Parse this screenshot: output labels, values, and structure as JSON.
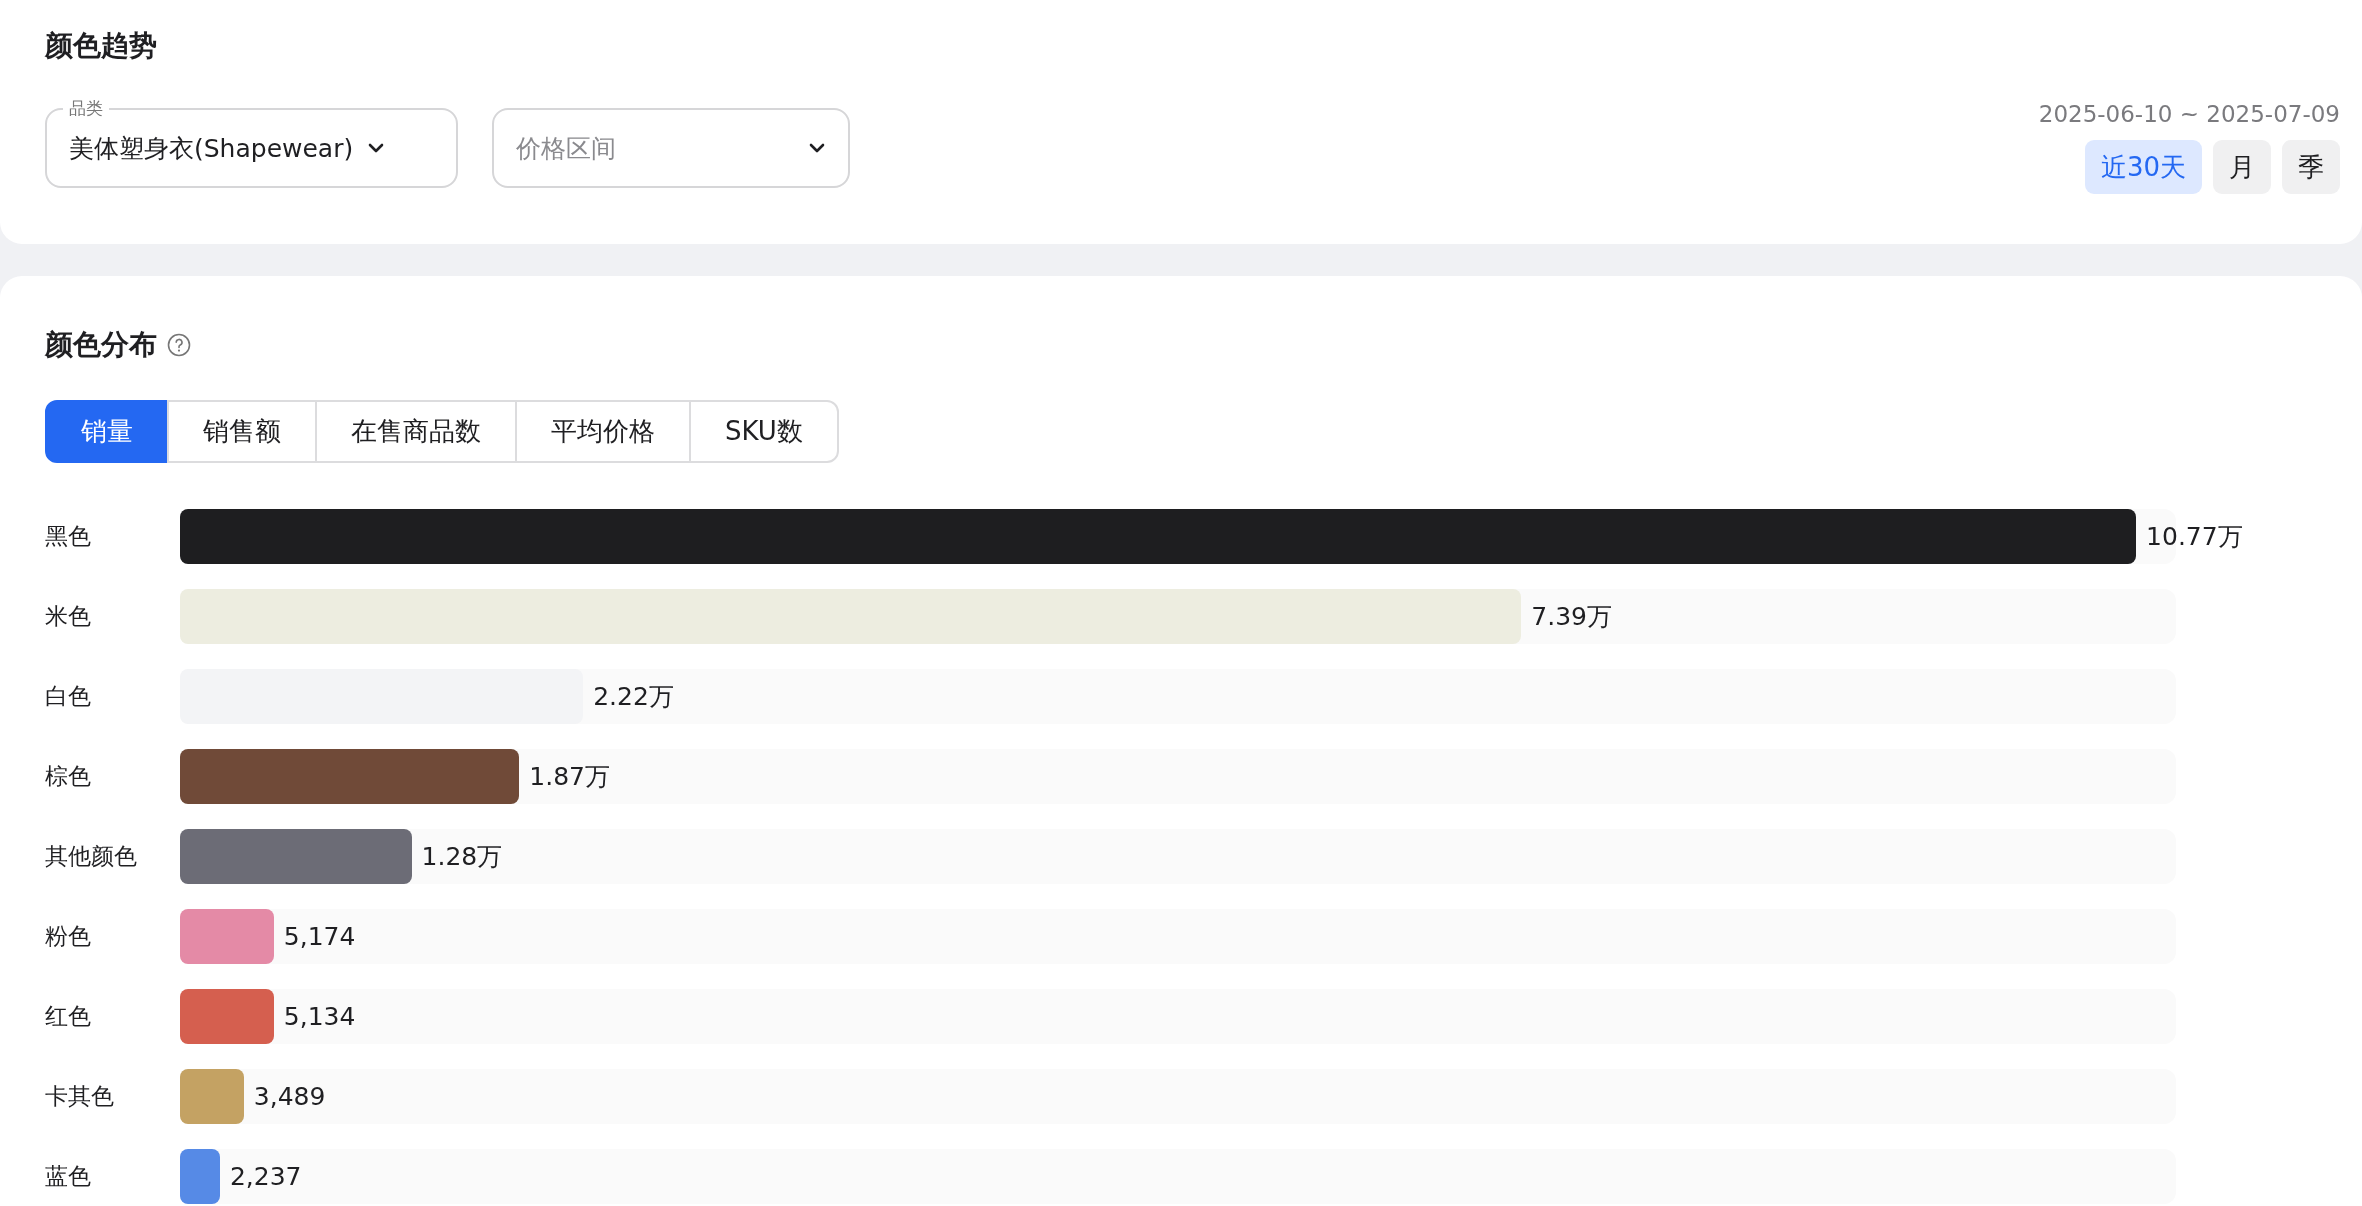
{
  "trend": {
    "title": "颜色趋势",
    "filters": [
      {
        "kind": "select",
        "label": "品类",
        "value": "美体塑身衣(Shapewear)"
      },
      {
        "kind": "select",
        "placeholder": "价格区间"
      }
    ],
    "date_range": "2025-06-10 ~ 2025-07-09",
    "periods": [
      {
        "label": "近30天",
        "selected": true
      },
      {
        "label": "月",
        "selected": false
      },
      {
        "label": "季",
        "selected": false
      }
    ]
  },
  "distribution": {
    "title": "颜色分布",
    "tabs": [
      {
        "label": "销量",
        "selected": true
      },
      {
        "label": "销售额",
        "selected": false
      },
      {
        "label": "在售商品数",
        "selected": false
      },
      {
        "label": "平均价格",
        "selected": false
      },
      {
        "label": "SKU数",
        "selected": false
      }
    ],
    "bars": [
      {
        "label": "黑色",
        "value": "10.77万",
        "level": 0.98,
        "color": "#1e1e20"
      },
      {
        "label": "米色",
        "value": "7.39万",
        "level": 0.672,
        "color": "#edede0"
      },
      {
        "label": "白色",
        "value": "2.22万",
        "level": 0.202,
        "color": "#f3f4f6"
      },
      {
        "label": "棕色",
        "value": "1.87万",
        "level": 0.17,
        "color": "#704a38"
      },
      {
        "label": "其他颜色",
        "value": "1.28万",
        "level": 0.116,
        "color": "#6c6c76"
      },
      {
        "label": "粉色",
        "value": "5,174",
        "level": 0.047,
        "color": "#e48aa6"
      },
      {
        "label": "红色",
        "value": "5,134",
        "level": 0.047,
        "color": "#d55f4f"
      },
      {
        "label": "卡其色",
        "value": "3,489",
        "level": 0.032,
        "color": "#c4a263"
      },
      {
        "label": "蓝色",
        "value": "2,237",
        "level": 0.02,
        "color": "#568ae6"
      }
    ]
  }
}
